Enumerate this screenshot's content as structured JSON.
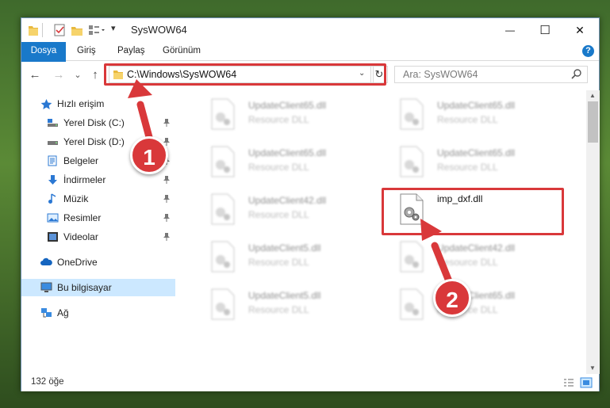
{
  "window": {
    "title": "SysWOW64",
    "minimize_glyph": "—",
    "maximize_glyph": "☐",
    "close_glyph": "✕"
  },
  "ribbon": {
    "tabs": [
      "Dosya",
      "Giriş",
      "Paylaş",
      "Görünüm"
    ],
    "help": "?"
  },
  "nav": {
    "back": "←",
    "forward": "→",
    "recent": "⌄",
    "up": "↑",
    "address": "C:\\Windows\\SysWOW64",
    "address_dropdown": "⌄",
    "refresh": "↻",
    "search_placeholder": "Ara: SysWOW64"
  },
  "sidebar": {
    "items": [
      {
        "label": "Hızlı erişim",
        "icon": "star-icon"
      },
      {
        "label": "Yerel Disk (C:)",
        "icon": "drive-icon"
      },
      {
        "label": "Yerel Disk (D:)",
        "icon": "drive-icon"
      },
      {
        "label": "Belgeler",
        "icon": "documents-icon"
      },
      {
        "label": "İndirmeler",
        "icon": "download-icon"
      },
      {
        "label": "Müzik",
        "icon": "music-icon"
      },
      {
        "label": "Resimler",
        "icon": "pictures-icon"
      },
      {
        "label": "Videolar",
        "icon": "videos-icon"
      },
      {
        "label": "OneDrive",
        "icon": "cloud-icon"
      },
      {
        "label": "Bu bilgisayar",
        "icon": "computer-icon"
      },
      {
        "label": "Ağ",
        "icon": "network-icon"
      }
    ]
  },
  "files": [
    {
      "name": "UpdateClient65.dll",
      "type": "Resource DLL"
    },
    {
      "name": "UpdateClient65.dll",
      "type": "Resource DLL"
    },
    {
      "name": "UpdateClient65.dll",
      "type": "Resource DLL"
    },
    {
      "name": "UpdateClient65.dll",
      "type": "Resource DLL"
    },
    {
      "name": "UpdateClient42.dll",
      "type": "Resource DLL"
    },
    {
      "name": "imp_dxf.dll",
      "type": ""
    },
    {
      "name": "UpdateClient5.dll",
      "type": "Resource DLL"
    },
    {
      "name": "UpdateClient42.dll",
      "type": "Resource DLL"
    },
    {
      "name": "UpdateClient5.dll",
      "type": "Resource DLL"
    },
    {
      "name": "UpdateClient65.dll",
      "type": "Resource DLL"
    }
  ],
  "status": {
    "item_count": "132 öğe"
  },
  "annotations": {
    "step1": "1",
    "step2": "2",
    "color": "#d9383a"
  }
}
